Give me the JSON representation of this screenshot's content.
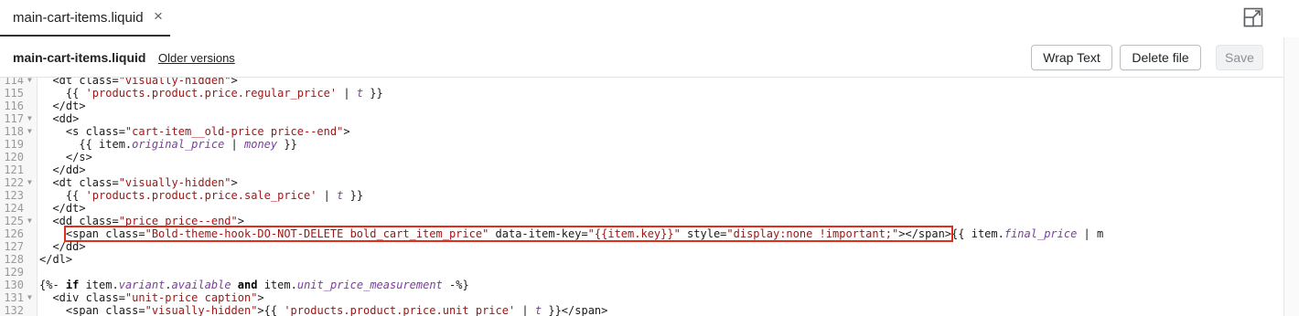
{
  "tab": {
    "label": "main-cart-items.liquid",
    "close": "×"
  },
  "header": {
    "file_title": "main-cart-items.liquid",
    "older_versions": "Older versions"
  },
  "toolbar": {
    "wrap_label": "Wrap Text",
    "delete_label": "Delete file",
    "save_label": "Save"
  },
  "icons": {
    "expand": "expand-icon",
    "close": "close-icon",
    "fold": "fold-arrow-icon"
  },
  "colors": {
    "highlight": "#e12d1a",
    "string": "#a31515",
    "variable": "#7a3e9d"
  },
  "code": {
    "highlighted_line": 126,
    "lines": [
      {
        "n": "114",
        "fold": true,
        "text": "  <dt class=\"visually-hidden\">"
      },
      {
        "n": "115",
        "fold": false,
        "text": "    {{ 'products.product.price.regular_price' | t }}"
      },
      {
        "n": "116",
        "fold": false,
        "text": "  </dt>"
      },
      {
        "n": "117",
        "fold": true,
        "text": "  <dd>"
      },
      {
        "n": "118",
        "fold": true,
        "text": "    <s class=\"cart-item__old-price price--end\">"
      },
      {
        "n": "119",
        "fold": false,
        "text": "      {{ item.original_price | money }}"
      },
      {
        "n": "120",
        "fold": false,
        "text": "    </s>"
      },
      {
        "n": "121",
        "fold": false,
        "text": "  </dd>"
      },
      {
        "n": "122",
        "fold": true,
        "text": "  <dt class=\"visually-hidden\">"
      },
      {
        "n": "123",
        "fold": false,
        "text": "    {{ 'products.product.price.sale_price' | t }}"
      },
      {
        "n": "124",
        "fold": false,
        "text": "  </dt>"
      },
      {
        "n": "125",
        "fold": true,
        "text": "  <dd class=\"price price--end\">"
      },
      {
        "n": "126",
        "fold": false,
        "text": "    <span class=\"Bold-theme-hook-DO-NOT-DELETE bold_cart_item_price\" data-item-key=\"{{item.key}}\" style=\"display:none !important;\"></span>{{ item.final_price | m"
      },
      {
        "n": "127",
        "fold": false,
        "text": "  </dd>"
      },
      {
        "n": "128",
        "fold": false,
        "text": "</dl>"
      },
      {
        "n": "129",
        "fold": false,
        "text": ""
      },
      {
        "n": "130",
        "fold": false,
        "text": "{%- if item.variant.available and item.unit_price_measurement -%}"
      },
      {
        "n": "131",
        "fold": true,
        "text": "  <div class=\"unit-price caption\">"
      },
      {
        "n": "132",
        "fold": false,
        "text": "    <span class=\"visually-hidden\">{{ 'products.product.price.unit_price' | t }}</span>"
      }
    ]
  }
}
